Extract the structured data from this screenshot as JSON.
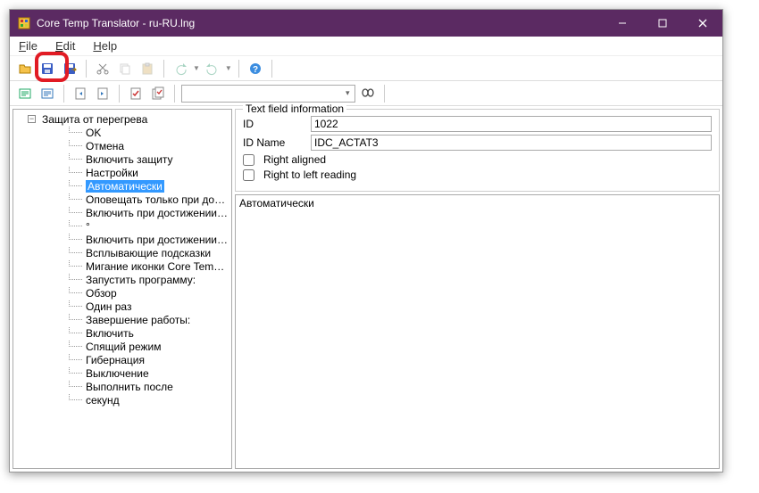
{
  "window": {
    "title": "Core Temp Translator - ru-RU.lng"
  },
  "menu": {
    "file": "File",
    "edit": "Edit",
    "help": "Help"
  },
  "tree": {
    "root_label": "Защита от перегрева",
    "selected_index": 4,
    "items": [
      "OK",
      "Отмена",
      "Включить защиту",
      "Настройки",
      "Автоматически",
      "Оповещать только при достижен",
      "Включить при достижении задан",
      "°",
      "Включить при достижении Tj.Max",
      "Всплывающие подсказки",
      "Мигание иконки Core Temp на па",
      "Запустить программу:",
      "Обзор",
      "Один раз",
      "Завершение работы:",
      "Включить",
      "Спящий режим",
      "Гибернация",
      "Выключение",
      "Выполнить после",
      "секунд"
    ]
  },
  "field_info": {
    "group_title": "Text field information",
    "id_label": "ID",
    "id_value": "1022",
    "idname_label": "ID Name",
    "idname_value": "IDC_ACTAT3",
    "right_aligned_label": "Right aligned",
    "right_aligned": false,
    "rtl_label": "Right to left reading",
    "rtl": false
  },
  "editor": {
    "text": "Автоматически"
  },
  "icons": {
    "save_color": "#2a4aa0",
    "scissors": "gray",
    "binoc": "#444"
  }
}
